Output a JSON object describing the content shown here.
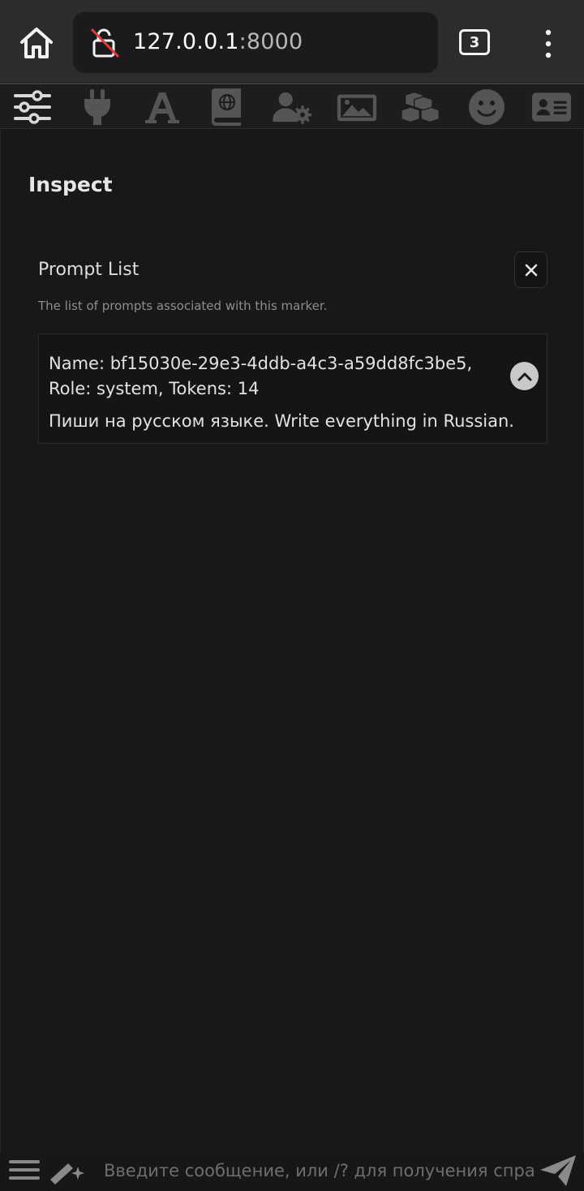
{
  "browser": {
    "url_host": "127.0.0.1",
    "url_port": ":8000",
    "tab_count": "3"
  },
  "top_nav": {
    "items": [
      {
        "name": "sliders-icon"
      },
      {
        "name": "plug-icon"
      },
      {
        "name": "font-icon"
      },
      {
        "name": "book-globe-icon"
      },
      {
        "name": "user-gear-icon"
      },
      {
        "name": "image-icon"
      },
      {
        "name": "cubes-icon"
      },
      {
        "name": "smile-icon"
      },
      {
        "name": "id-card-icon"
      }
    ]
  },
  "panel": {
    "title": "Inspect",
    "section_title": "Prompt List",
    "section_desc": "The list of prompts associated with this marker.",
    "prompts": [
      {
        "header_line1": "Name: bf15030e-29e3-4ddb-a4c3-a59dd8fc3be5,",
        "header_line2": "Role: system, Tokens: 14",
        "content": "Пиши на русском языке. Write everything in Russian."
      }
    ]
  },
  "bottom": {
    "input_placeholder": "Введите сообщение, или /? для получения справки"
  }
}
